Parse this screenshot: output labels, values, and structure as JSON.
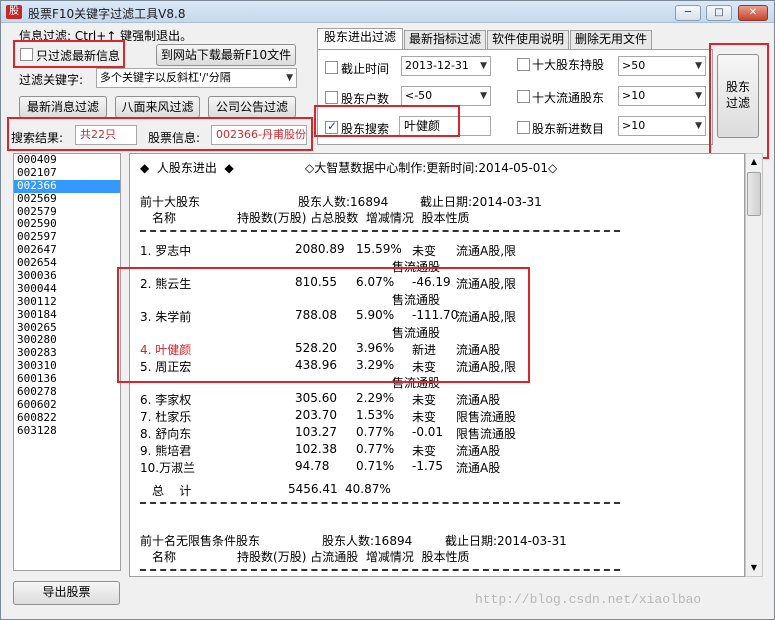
{
  "window": {
    "title": "股票F10关键字过滤工具V8.8"
  },
  "top": {
    "info": "信息过滤: Ctrl+↑ 键强制退出。",
    "only_new_label": "只过滤最新信息",
    "download_btn": "到网站下载最新F10文件",
    "keyword_label": "过滤关键字:",
    "keyword_value": "多个关键字以反斜杠'/'分隔",
    "btn_news": "最新消息过滤",
    "btn_eight": "八面来风过滤",
    "btn_announce": "公司公告过滤",
    "result_label": "搜索结果:",
    "result_value": "共22只",
    "stock_info_label": "股票信息:",
    "stock_info_value": "002366-丹甫股份"
  },
  "tabs": [
    "股东进出过滤",
    "最新指标过滤",
    "软件使用说明",
    "删除无用文件"
  ],
  "filters": {
    "deadline_label": "截止时间",
    "deadline_value": "2013-12-31",
    "holders_count_label": "股东户数",
    "holders_count_value": "<-50",
    "search_label": "股东搜索",
    "search_value": "叶健颜",
    "top10_label": "十大股东持股",
    "top10_value": ">50",
    "top10flow_label": "十大流通股东",
    "top10flow_value": ">10",
    "newin_label": "股东新进数目",
    "newin_value": ">10",
    "big_btn": "股东\n过滤"
  },
  "stock_list": [
    "000409",
    "002107",
    "002366",
    "002569",
    "002579",
    "002590",
    "002597",
    "002647",
    "002654",
    "300036",
    "300044",
    "300112",
    "300184",
    "300265",
    "300280",
    "300283",
    "300310",
    "600136",
    "600278",
    "600602",
    "600822",
    "603128"
  ],
  "selected_stock": "002366",
  "content": {
    "header": "◆  人股东进出  ◆",
    "source": "◇大智慧数据中心制作:更新时间:2014-05-01◇",
    "sec1_title": "前十大股东",
    "sec1_count": "股东人数:16894",
    "sec1_date": "截止日期:2014-03-31",
    "sec1_cols": "名称                持股数(万股) 占总股数  增减情况  股本性质",
    "rows": [
      {
        "name": "1. 罗志中",
        "shares": "2080.89",
        "pct": "15.59%",
        "chg": "未变",
        "type": "流通A股,限",
        "cont": "售流通股"
      },
      {
        "name": "2. 熊云生",
        "shares": "810.55",
        "pct": "6.07%",
        "chg": "-46.19",
        "type": "流通A股,限",
        "cont": "售流通股"
      },
      {
        "name": "3. 朱学前",
        "shares": "788.08",
        "pct": "5.90%",
        "chg": "-111.70",
        "type": "流通A股,限",
        "cont": "售流通股"
      },
      {
        "name": "4. 叶健颜",
        "shares": "528.20",
        "pct": "3.96%",
        "chg": "新进",
        "type": "流通A股",
        "cont": ""
      },
      {
        "name": "5. 周正宏",
        "shares": "438.96",
        "pct": "3.29%",
        "chg": "未变",
        "type": "流通A股,限",
        "cont": "售流通股"
      },
      {
        "name": "6. 李家权",
        "shares": "305.60",
        "pct": "2.29%",
        "chg": "未变",
        "type": "流通A股",
        "cont": ""
      },
      {
        "name": "7. 杜家乐",
        "shares": "203.70",
        "pct": "1.53%",
        "chg": "未变",
        "type": "限售流通股",
        "cont": ""
      },
      {
        "name": "8. 舒向东",
        "shares": "103.27",
        "pct": "0.77%",
        "chg": "-0.01",
        "type": "限售流通股",
        "cont": ""
      },
      {
        "name": "9. 熊培君",
        "shares": "102.38",
        "pct": "0.77%",
        "chg": "未变",
        "type": "流通A股",
        "cont": ""
      },
      {
        "name": "10.万淑兰",
        "shares": "94.78",
        "pct": "0.71%",
        "chg": "-1.75",
        "type": "流通A股",
        "cont": ""
      }
    ],
    "total_label": "总    计",
    "total_shares": "5456.41",
    "total_pct": "40.87%",
    "sec2_title": "前十名无限售条件股东",
    "sec2_count": "股东人数:16894",
    "sec2_date": "截止日期:2014-03-31",
    "sec2_cols": "名称                持股数(万股) 占流通股  增减情况  股本性质"
  },
  "export_btn": "导出股票",
  "watermark": "http://blog.csdn.net/xiaolbao"
}
